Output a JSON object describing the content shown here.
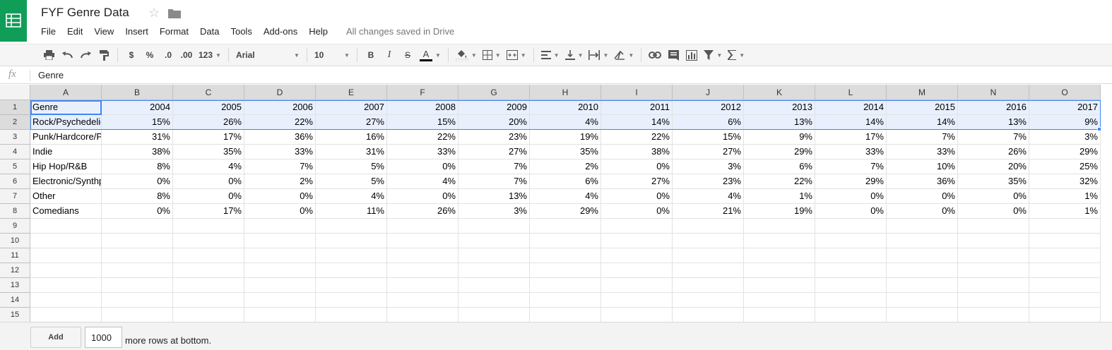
{
  "header": {
    "title": "FYF Genre Data",
    "save_status": "All changes saved in Drive"
  },
  "menu": [
    "File",
    "Edit",
    "View",
    "Insert",
    "Format",
    "Data",
    "Tools",
    "Add-ons",
    "Help"
  ],
  "toolbar": {
    "currency": "$",
    "percent": "%",
    "decrease_decimal": ".0",
    "increase_decimal": ".00",
    "more_formats": "123",
    "font": "Arial",
    "font_size": "10",
    "bold": "B",
    "italic": "I",
    "strike": "S",
    "text_color": "A",
    "text_color_hex": "#000000"
  },
  "formula_bar": {
    "fx": "fx",
    "value": "Genre"
  },
  "sheet": {
    "columns": [
      "A",
      "B",
      "C",
      "D",
      "E",
      "F",
      "G",
      "H",
      "I",
      "J",
      "K",
      "L",
      "M",
      "N",
      "O"
    ],
    "row_numbers": [
      "1",
      "2",
      "3",
      "4",
      "5",
      "6",
      "7",
      "8",
      "9",
      "10",
      "11",
      "12",
      "13",
      "14",
      "15"
    ],
    "rows": [
      [
        "Genre",
        "2004",
        "2005",
        "2006",
        "2007",
        "2008",
        "2009",
        "2010",
        "2011",
        "2012",
        "2013",
        "2014",
        "2015",
        "2016",
        "2017"
      ],
      [
        "Rock/Psychedelic",
        "15%",
        "26%",
        "22%",
        "27%",
        "15%",
        "20%",
        "4%",
        "14%",
        "6%",
        "13%",
        "14%",
        "14%",
        "13%",
        "9%"
      ],
      [
        "Punk/Hardcore/Post-Punk",
        "31%",
        "17%",
        "36%",
        "16%",
        "22%",
        "23%",
        "19%",
        "22%",
        "15%",
        "9%",
        "17%",
        "7%",
        "7%",
        "3%"
      ],
      [
        "Indie",
        "38%",
        "35%",
        "33%",
        "31%",
        "33%",
        "27%",
        "35%",
        "38%",
        "27%",
        "29%",
        "33%",
        "33%",
        "26%",
        "29%"
      ],
      [
        "Hip Hop/R&B",
        "8%",
        "4%",
        "7%",
        "5%",
        "0%",
        "7%",
        "2%",
        "0%",
        "3%",
        "6%",
        "7%",
        "10%",
        "20%",
        "25%"
      ],
      [
        "Electronic/Synthpop",
        "0%",
        "0%",
        "2%",
        "5%",
        "4%",
        "7%",
        "6%",
        "27%",
        "23%",
        "22%",
        "29%",
        "36%",
        "35%",
        "32%"
      ],
      [
        "Other",
        "8%",
        "0%",
        "0%",
        "4%",
        "0%",
        "13%",
        "4%",
        "0%",
        "4%",
        "1%",
        "0%",
        "0%",
        "0%",
        "1%"
      ],
      [
        "Comedians",
        "0%",
        "17%",
        "0%",
        "11%",
        "26%",
        "3%",
        "29%",
        "0%",
        "21%",
        "19%",
        "0%",
        "0%",
        "0%",
        "1%"
      ]
    ],
    "selected_row_numbers": [
      "1",
      "2"
    ],
    "accent_color": "#4285f4",
    "selection_fill": "#e8f0fe"
  },
  "footer": {
    "add_label": "Add",
    "rows_value": "1000",
    "rows_suffix": "more rows at bottom."
  },
  "colors": {
    "brand_green": "#0f9d58"
  }
}
